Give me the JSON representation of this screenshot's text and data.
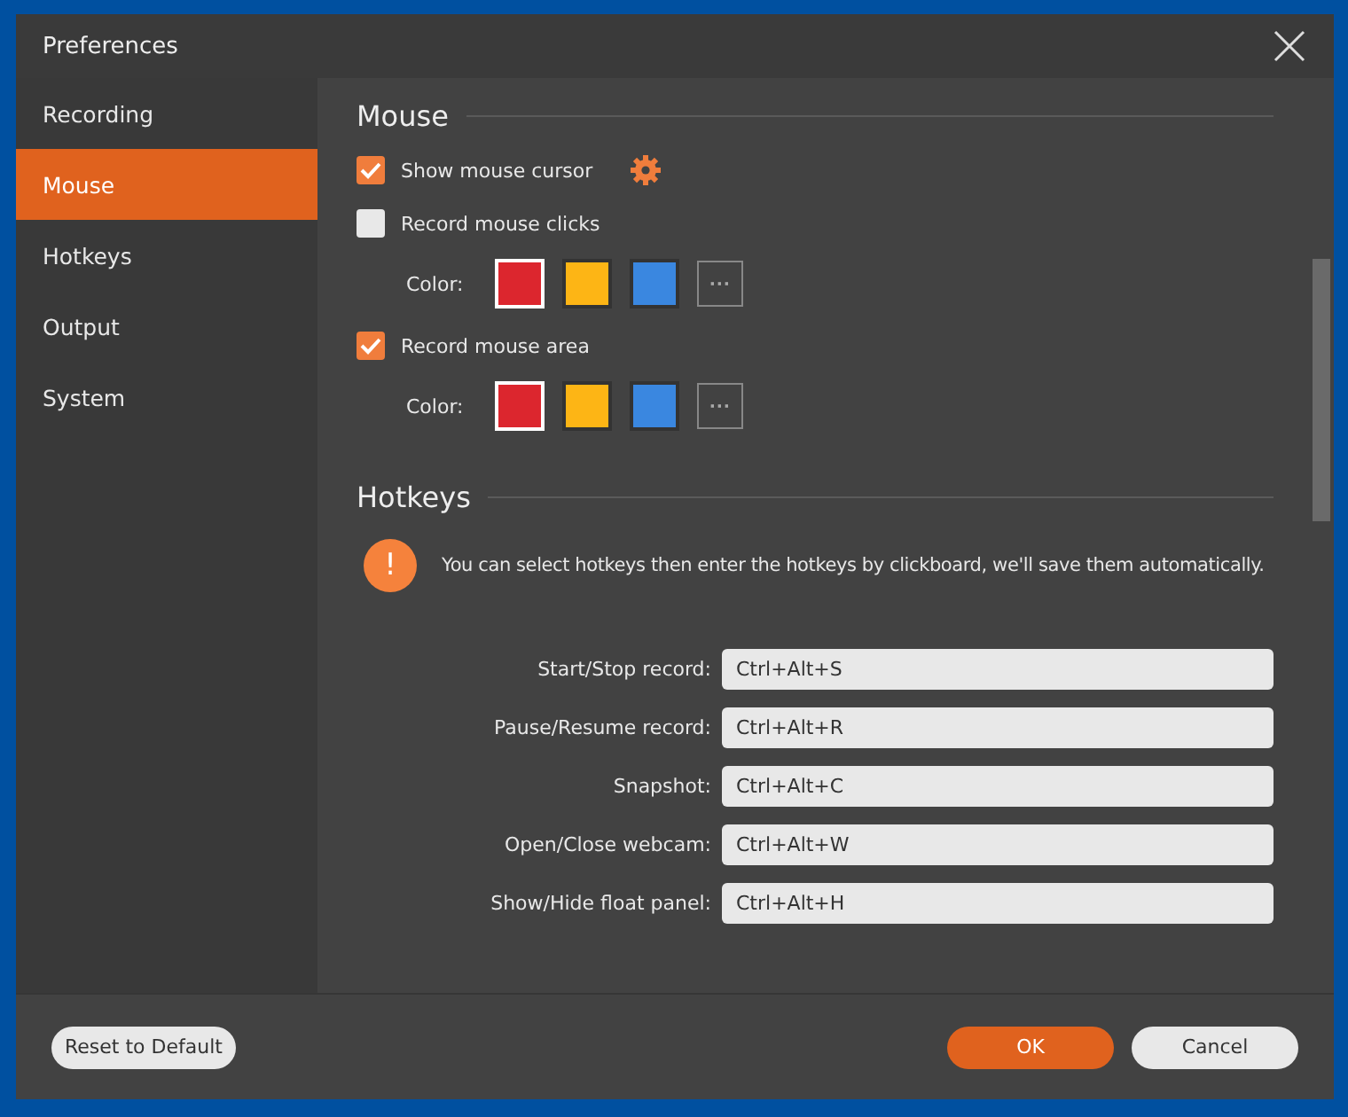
{
  "window": {
    "title": "Preferences"
  },
  "sidebar": {
    "items": [
      {
        "label": "Recording",
        "selected": false
      },
      {
        "label": "Mouse",
        "selected": true
      },
      {
        "label": "Hotkeys",
        "selected": false
      },
      {
        "label": "Output",
        "selected": false
      },
      {
        "label": "System",
        "selected": false
      }
    ]
  },
  "mouse": {
    "title": "Mouse",
    "options": [
      {
        "label": "Show mouse cursor",
        "checked": true,
        "settings": true
      },
      {
        "label": "Record mouse clicks",
        "checked": false,
        "color_label": "Color:",
        "swatches": [
          {
            "color": "#dc262e",
            "selected": true
          },
          {
            "color": "#fdb515",
            "selected": false
          },
          {
            "color": "#3a87e0",
            "selected": false
          }
        ],
        "more": "···"
      },
      {
        "label": "Record mouse area",
        "checked": true,
        "color_label": "Color:",
        "swatches": [
          {
            "color": "#dc262e",
            "selected": true
          },
          {
            "color": "#fdb515",
            "selected": false
          },
          {
            "color": "#3a87e0",
            "selected": false
          }
        ],
        "more": "···"
      }
    ]
  },
  "hotkeys": {
    "title": "Hotkeys",
    "notice_icon": "!",
    "notice": "You can select hotkeys then enter the hotkeys by clickboard, we'll save them automatically.",
    "rows": [
      {
        "label": "Start/Stop record:",
        "value": "Ctrl+Alt+S"
      },
      {
        "label": "Pause/Resume record:",
        "value": "Ctrl+Alt+R"
      },
      {
        "label": "Snapshot:",
        "value": "Ctrl+Alt+C"
      },
      {
        "label": "Open/Close webcam:",
        "value": "Ctrl+Alt+W"
      },
      {
        "label": "Show/Hide float panel:",
        "value": "Ctrl+Alt+H"
      }
    ]
  },
  "buttons": {
    "reset": "Reset to Default",
    "ok": "OK",
    "cancel": "Cancel"
  }
}
